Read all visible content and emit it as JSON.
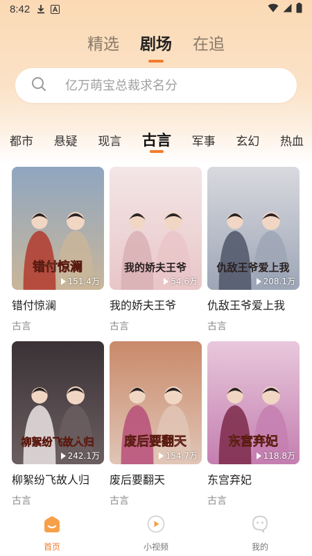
{
  "status_bar": {
    "time": "8:42"
  },
  "main_tabs": [
    {
      "label": "精选",
      "active": false
    },
    {
      "label": "剧场",
      "active": true
    },
    {
      "label": "在追",
      "active": false
    }
  ],
  "search": {
    "placeholder": "亿万萌宝总裁求名分"
  },
  "categories": [
    {
      "label": "都市",
      "active": false
    },
    {
      "label": "悬疑",
      "active": false
    },
    {
      "label": "现言",
      "active": false
    },
    {
      "label": "古言",
      "active": true
    },
    {
      "label": "军事",
      "active": false
    },
    {
      "label": "玄幻",
      "active": false
    },
    {
      "label": "热血",
      "active": false
    }
  ],
  "cards": [
    {
      "title": "错付惊澜",
      "genre": "古言",
      "views": "151.4万",
      "poster_text": "错付惊澜",
      "colors": [
        "#8fa6c0",
        "#c9b69a",
        "#b23a2e"
      ]
    },
    {
      "title": "我的娇夫王爷",
      "genre": "古言",
      "views": "54.6万",
      "poster_text": "我的娇夫王爷",
      "colors": [
        "#f3e6e6",
        "#e9c6c8",
        "#d8b0b4"
      ]
    },
    {
      "title": "仇敌王爷爱上我",
      "genre": "古言",
      "views": "208.1万",
      "poster_text": "仇敌王爷爱上我",
      "colors": [
        "#d9d9df",
        "#9da6b6",
        "#4f5668"
      ]
    },
    {
      "title": "柳絮纷飞故人归",
      "genre": "古言",
      "views": "242.1万",
      "poster_text": "柳絮纷飞故人归",
      "colors": [
        "#3a3236",
        "#6b5e60",
        "#ebe4e4"
      ]
    },
    {
      "title": "废后要翻天",
      "genre": "古言",
      "views": "154.7万",
      "poster_text": "废后要翻天",
      "colors": [
        "#c98a6a",
        "#e0c5b6",
        "#b74f7a"
      ]
    },
    {
      "title": "东宫弃妃",
      "genre": "古言",
      "views": "118.8万",
      "poster_text": "东宫弃妃",
      "colors": [
        "#e8c8dc",
        "#c47fb0",
        "#7d2a4a"
      ]
    }
  ],
  "bottom_nav": [
    {
      "label": "首页",
      "icon": "home-icon",
      "active": true
    },
    {
      "label": "小视频",
      "icon": "play-circle-icon",
      "active": false
    },
    {
      "label": "我的",
      "icon": "profile-icon",
      "active": false
    }
  ],
  "colors": {
    "accent": "#f27c2c",
    "header_bg": "#fbd9b4"
  }
}
